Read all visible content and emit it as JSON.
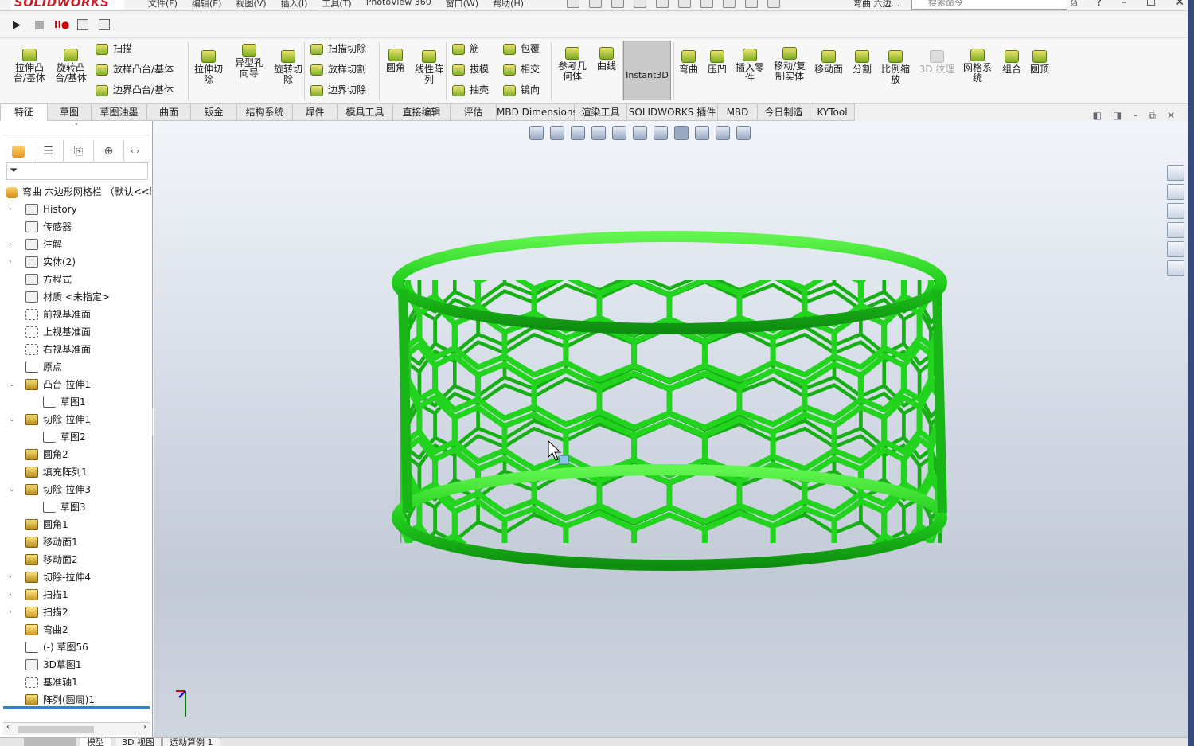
{
  "app": {
    "logo": "SOLIDWORKS",
    "menu": [
      "文件(F)",
      "编辑(E)",
      "视图(V)",
      "插入(I)",
      "工具(T)",
      "PhotoView 360",
      "窗口(W)",
      "帮助(H)"
    ],
    "doc_title": "弯曲 六边...",
    "search_placeholder": "搜索命令"
  },
  "ribbon": {
    "big": [
      {
        "id": "extrude-boss",
        "label": "拉伸凸台/基体"
      },
      {
        "id": "revolve-boss",
        "label": "旋转凸台/基体"
      },
      {
        "id": "extrude-cut",
        "label": "拉伸切除"
      },
      {
        "id": "hole-wizard",
        "label": "异型孔向导"
      },
      {
        "id": "revolve-cut",
        "label": "旋转切除"
      },
      {
        "id": "fillet",
        "label": "圆角"
      },
      {
        "id": "linear-pattern",
        "label": "线性阵列"
      },
      {
        "id": "ref-geometry",
        "label": "参考几何体"
      },
      {
        "id": "curves",
        "label": "曲线"
      },
      {
        "id": "flex",
        "label": "弯曲"
      },
      {
        "id": "indent",
        "label": "压凹"
      },
      {
        "id": "insert-part",
        "label": "插入零件"
      },
      {
        "id": "move-copy",
        "label": "移动/复制实体"
      },
      {
        "id": "move-face",
        "label": "移动面"
      },
      {
        "id": "split",
        "label": "分割"
      },
      {
        "id": "scale",
        "label": "比例缩放"
      },
      {
        "id": "3d-texture",
        "label": "3D 纹理"
      },
      {
        "id": "mesh-system",
        "label": "网格系统"
      },
      {
        "id": "combine",
        "label": "组合"
      },
      {
        "id": "dome",
        "label": "圆顶"
      }
    ],
    "small": [
      {
        "id": "sweep",
        "label": "扫描"
      },
      {
        "id": "loft",
        "label": "放样凸台/基体"
      },
      {
        "id": "boundary",
        "label": "边界凸台/基体"
      },
      {
        "id": "sweep-cut",
        "label": "扫描切除"
      },
      {
        "id": "loft-cut",
        "label": "放样切割"
      },
      {
        "id": "boundary-cut",
        "label": "边界切除"
      },
      {
        "id": "rib",
        "label": "筋"
      },
      {
        "id": "draft",
        "label": "拔模"
      },
      {
        "id": "shell",
        "label": "抽壳"
      },
      {
        "id": "wrap",
        "label": "包覆"
      },
      {
        "id": "intersect",
        "label": "相交"
      },
      {
        "id": "mirror",
        "label": "镜向"
      }
    ],
    "instant3d": "Instant3D"
  },
  "tabs": [
    "特征",
    "草图",
    "草图油墨",
    "曲面",
    "钣金",
    "结构系统",
    "焊件",
    "模具工具",
    "直接编辑",
    "评估",
    "MBD Dimensions",
    "渲染工具",
    "SOLIDWORKS 插件",
    "MBD",
    "今日制造",
    "KYTool"
  ],
  "tree": {
    "root": "弯曲 六边形网格栏 （默认<<默",
    "items": [
      {
        "label": "History",
        "arrow": "›",
        "indent": 0,
        "icon": "folder"
      },
      {
        "label": "传感器",
        "arrow": "",
        "indent": 0,
        "icon": "folder"
      },
      {
        "label": "注解",
        "arrow": "›",
        "indent": 0,
        "icon": "folder"
      },
      {
        "label": "实体(2)",
        "arrow": "›",
        "indent": 0,
        "icon": "folder"
      },
      {
        "label": "方程式",
        "arrow": "",
        "indent": 0,
        "icon": "folder"
      },
      {
        "label": "材质 <未指定>",
        "arrow": "",
        "indent": 0,
        "icon": "material"
      },
      {
        "label": "前视基准面",
        "arrow": "",
        "indent": 0,
        "icon": "plane"
      },
      {
        "label": "上视基准面",
        "arrow": "",
        "indent": 0,
        "icon": "plane"
      },
      {
        "label": "右视基准面",
        "arrow": "",
        "indent": 0,
        "icon": "plane"
      },
      {
        "label": "原点",
        "arrow": "",
        "indent": 0,
        "icon": "origin"
      },
      {
        "label": "凸台-拉伸1",
        "arrow": "⌄",
        "indent": 0,
        "icon": "feature"
      },
      {
        "label": "草图1",
        "arrow": "",
        "indent": 1,
        "icon": "sketch"
      },
      {
        "label": "切除-拉伸1",
        "arrow": "⌄",
        "indent": 0,
        "icon": "feature"
      },
      {
        "label": "草图2",
        "arrow": "",
        "indent": 1,
        "icon": "sketch"
      },
      {
        "label": "圆角2",
        "arrow": "",
        "indent": 0,
        "icon": "feature"
      },
      {
        "label": "填充阵列1",
        "arrow": "",
        "indent": 0,
        "icon": "feature"
      },
      {
        "label": "切除-拉伸3",
        "arrow": "⌄",
        "indent": 0,
        "icon": "feature"
      },
      {
        "label": "草图3",
        "arrow": "",
        "indent": 1,
        "icon": "sketch"
      },
      {
        "label": "圆角1",
        "arrow": "",
        "indent": 0,
        "icon": "feature"
      },
      {
        "label": "移动面1",
        "arrow": "",
        "indent": 0,
        "icon": "feature"
      },
      {
        "label": "移动面2",
        "arrow": "",
        "indent": 0,
        "icon": "feature"
      },
      {
        "label": "切除-拉伸4",
        "arrow": "›",
        "indent": 0,
        "icon": "feature"
      },
      {
        "label": "扫描1",
        "arrow": "›",
        "indent": 0,
        "icon": "bend"
      },
      {
        "label": "扫描2",
        "arrow": "›",
        "indent": 0,
        "icon": "bend"
      },
      {
        "label": "弯曲2",
        "arrow": "",
        "indent": 0,
        "icon": "bend"
      },
      {
        "label": "(-) 草图56",
        "arrow": "",
        "indent": 0,
        "icon": "sketch"
      },
      {
        "label": "3D草图1",
        "arrow": "",
        "indent": 0,
        "icon": "sketch3d"
      },
      {
        "label": "基准轴1",
        "arrow": "",
        "indent": 0,
        "icon": "axis"
      },
      {
        "label": "阵列(圆周)1",
        "arrow": "",
        "indent": 0,
        "icon": "pattern"
      }
    ]
  },
  "bottom_tabs": [
    "模型",
    "3D 视图",
    "运动算例 1"
  ],
  "model": {
    "color": "#22d41e",
    "highlight": "#5cf04f",
    "shadow": "#108a10"
  }
}
